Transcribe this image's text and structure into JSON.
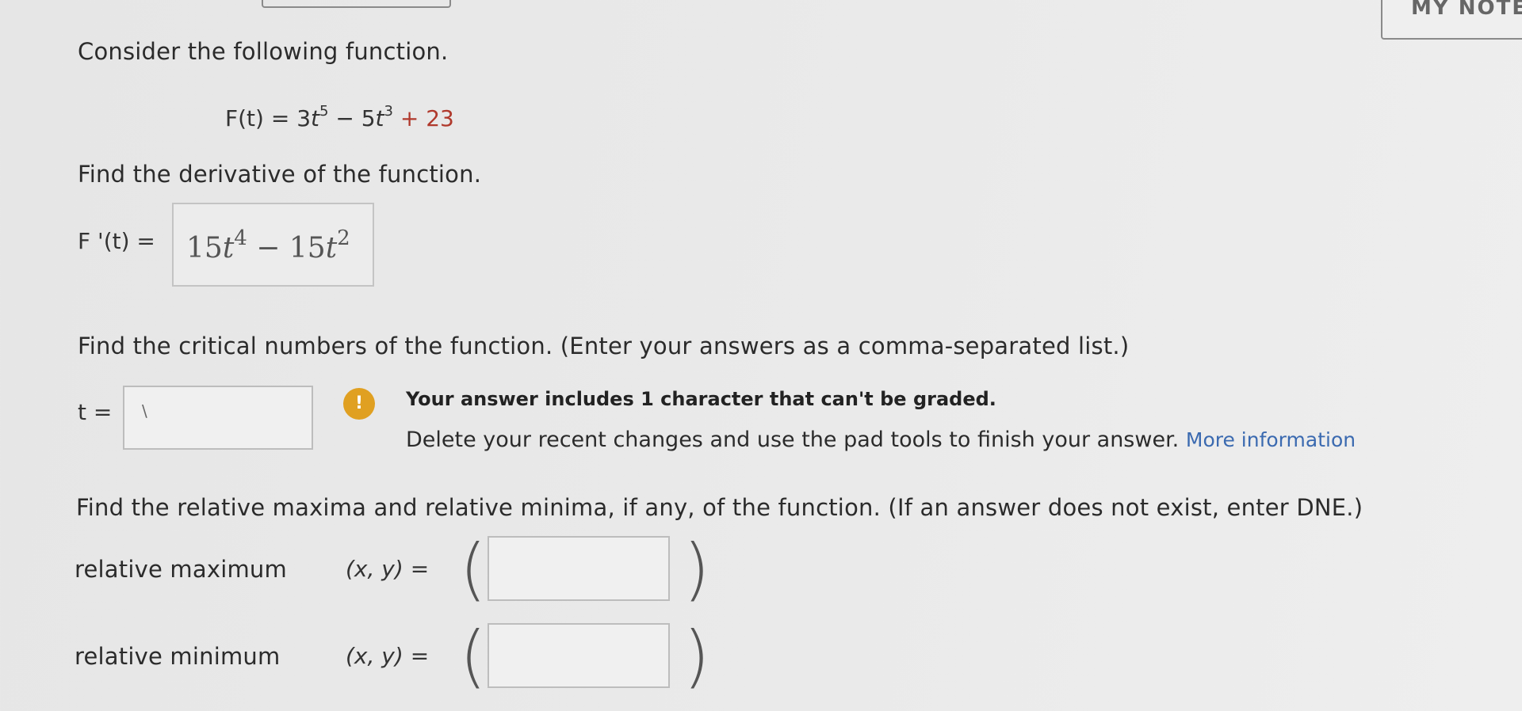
{
  "header": {
    "my_notes_label": "MY NOTE"
  },
  "question": {
    "intro": "Consider the following function.",
    "function_lhs": "F(t) = 3",
    "function_term2": " − 5",
    "function_term3": " + 23",
    "exp5": "5",
    "exp3": "3",
    "var": "t"
  },
  "derivative": {
    "prompt": "Find the derivative of the function.",
    "label": "F '(t) =",
    "answer_coef1": "15",
    "answer_exp1": "4",
    "answer_minus": " − 15",
    "answer_exp2": "2",
    "var": "t"
  },
  "critical": {
    "prompt": "Find the critical numbers of the function. (Enter your answers as a comma-separated list.)",
    "label": "t =",
    "input_value": "\\",
    "warning_icon": "!",
    "warning_title": "Your answer includes 1 character that can't be graded.",
    "warning_body": "Delete your recent changes and use the pad tools to finish your answer.",
    "more_info": "More information"
  },
  "extrema": {
    "prompt": "Find the relative maxima and relative minima, if any, of the function. (If an answer does not exist, enter DNE.)",
    "max_label": "relative maximum",
    "min_label": "relative minimum",
    "xy_label": "(x, y)  =",
    "open_paren": "(",
    "close_paren": ")"
  },
  "colors": {
    "accent_link": "#3b6ab0",
    "warning": "#e0a021",
    "constant_red": "#b0392c"
  }
}
